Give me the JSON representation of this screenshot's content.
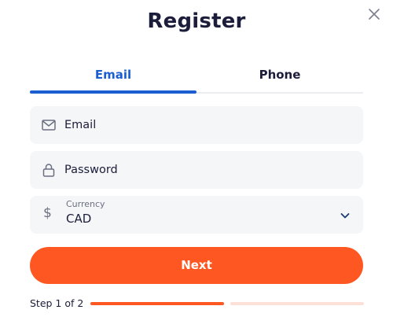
{
  "modal": {
    "title": "Register",
    "close_icon": "close-icon"
  },
  "tabs": [
    {
      "label": "Email",
      "active": true
    },
    {
      "label": "Phone",
      "active": false
    }
  ],
  "fields": {
    "email": {
      "placeholder": "Email",
      "icon": "envelope-icon"
    },
    "password": {
      "placeholder": "Password",
      "icon": "lock-icon"
    },
    "currency": {
      "label": "Currency",
      "value": "CAD",
      "icon": "dollar-icon",
      "dollar_symbol": "$"
    }
  },
  "next_button": {
    "label": "Next"
  },
  "progress": {
    "text": "Step 1 of 2",
    "current_step": 1,
    "total_steps": 2
  },
  "colors": {
    "accent": "#ff5722",
    "tab_active": "#1a5ed1",
    "text_dark": "#1b1d3a",
    "field_bg": "#f5f6f8"
  }
}
